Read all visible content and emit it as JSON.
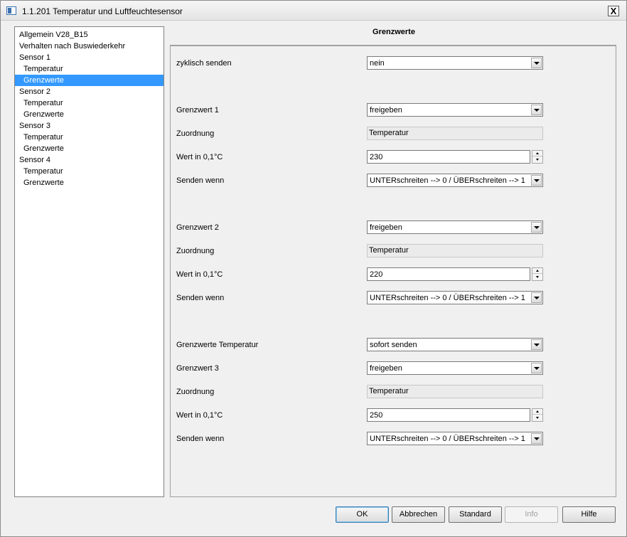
{
  "window": {
    "title": "1.1.201 Temperatur und Luftfeuchtesensor",
    "close_label": "X"
  },
  "tree": {
    "items": [
      {
        "label": "Allgemein V28_B15",
        "child": false,
        "selected": false
      },
      {
        "label": "Verhalten nach Buswiederkehr",
        "child": false,
        "selected": false
      },
      {
        "label": "Sensor 1",
        "child": false,
        "selected": false
      },
      {
        "label": "Temperatur",
        "child": true,
        "selected": false
      },
      {
        "label": "Grenzwerte",
        "child": true,
        "selected": true
      },
      {
        "label": "Sensor 2",
        "child": false,
        "selected": false
      },
      {
        "label": "Temperatur",
        "child": true,
        "selected": false
      },
      {
        "label": "Grenzwerte",
        "child": true,
        "selected": false
      },
      {
        "label": "Sensor 3",
        "child": false,
        "selected": false
      },
      {
        "label": "Temperatur",
        "child": true,
        "selected": false
      },
      {
        "label": "Grenzwerte",
        "child": true,
        "selected": false
      },
      {
        "label": "Sensor 4",
        "child": false,
        "selected": false
      },
      {
        "label": "Temperatur",
        "child": true,
        "selected": false
      },
      {
        "label": "Grenzwerte",
        "child": true,
        "selected": false
      }
    ]
  },
  "section_title": "Grenzwerte",
  "params": {
    "zyklisch": {
      "label": "zyklisch senden",
      "value": "nein"
    },
    "gw1": {
      "label": "Grenzwert 1",
      "value": "freigeben"
    },
    "zuo1": {
      "label": "Zuordnung",
      "value": "Temperatur"
    },
    "wert1": {
      "label": "Wert in 0,1°C",
      "value": "230"
    },
    "senden1": {
      "label": "Senden wenn",
      "value": "UNTERschreiten --> 0 / ÜBERschreiten --> 1"
    },
    "gw2": {
      "label": "Grenzwert 2",
      "value": "freigeben"
    },
    "zuo2": {
      "label": "Zuordnung",
      "value": "Temperatur"
    },
    "wert2": {
      "label": "Wert in 0,1°C",
      "value": "220"
    },
    "senden2": {
      "label": "Senden wenn",
      "value": "UNTERschreiten --> 0 / ÜBERschreiten --> 1"
    },
    "gwtemp": {
      "label": "Grenzwerte Temperatur",
      "value": "sofort senden"
    },
    "gw3": {
      "label": "Grenzwert 3",
      "value": "freigeben"
    },
    "zuo3": {
      "label": "Zuordnung",
      "value": "Temperatur"
    },
    "wert3": {
      "label": "Wert in 0,1°C",
      "value": "250"
    },
    "senden3": {
      "label": "Senden wenn",
      "value": "UNTERschreiten --> 0 / ÜBERschreiten --> 1"
    }
  },
  "footer": {
    "ok": "OK",
    "abbrechen": "Abbrechen",
    "standard": "Standard",
    "info": "Info",
    "hilfe": "Hilfe"
  },
  "colors": {
    "selection": "#3399ff",
    "window_bg": "#f0f0f0"
  }
}
